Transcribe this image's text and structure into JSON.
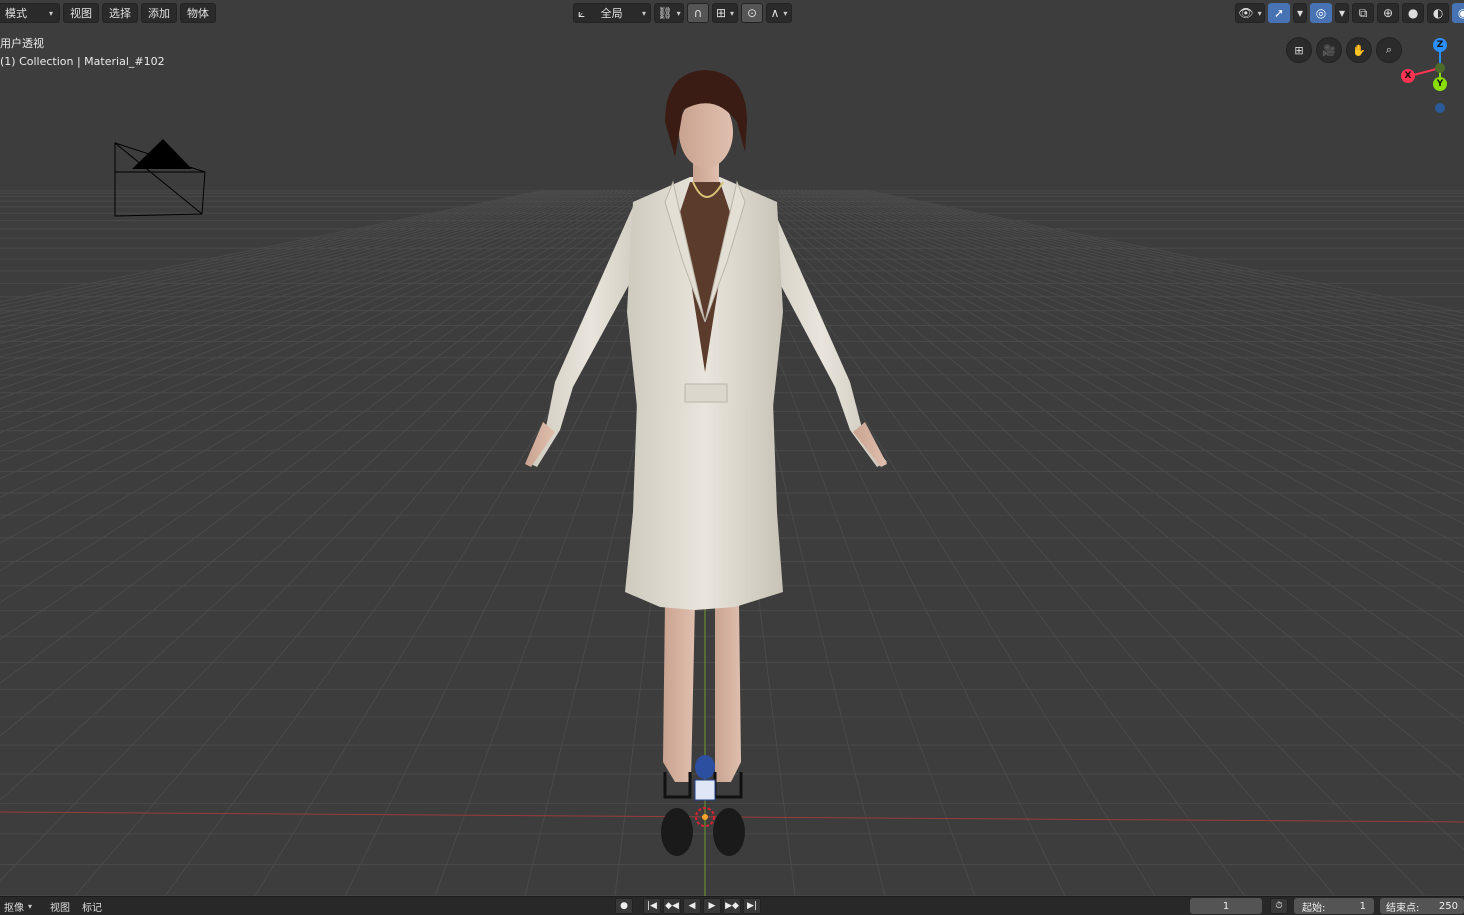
{
  "header": {
    "mode_select": "模式",
    "menus": [
      "视图",
      "选择",
      "添加",
      "物体"
    ],
    "transform_orientation": "全局"
  },
  "viewport": {
    "view_name": "用户透视",
    "collection_info": "(1) Collection | Material_#102"
  },
  "gizmo": {
    "z_label": "Z",
    "x_label": "X",
    "y_label": "Y",
    "z_color": "#2c8fff",
    "x_color": "#ff3352",
    "y_color": "#8bdc00"
  },
  "timeline": {
    "editor_select": "抠像",
    "menus": [
      "视图",
      "标记"
    ],
    "current_frame": "1",
    "start_label": "起始:",
    "start_value": "1",
    "end_label": "结束点:",
    "end_value": "250"
  },
  "colors": {
    "viewport_bg": "#3d3d3d",
    "grid_line": "#4a4a4a",
    "x_axis_line": "#9a3b3b",
    "y_axis_line": "#6d9a2c",
    "accent": "#4772b3"
  }
}
